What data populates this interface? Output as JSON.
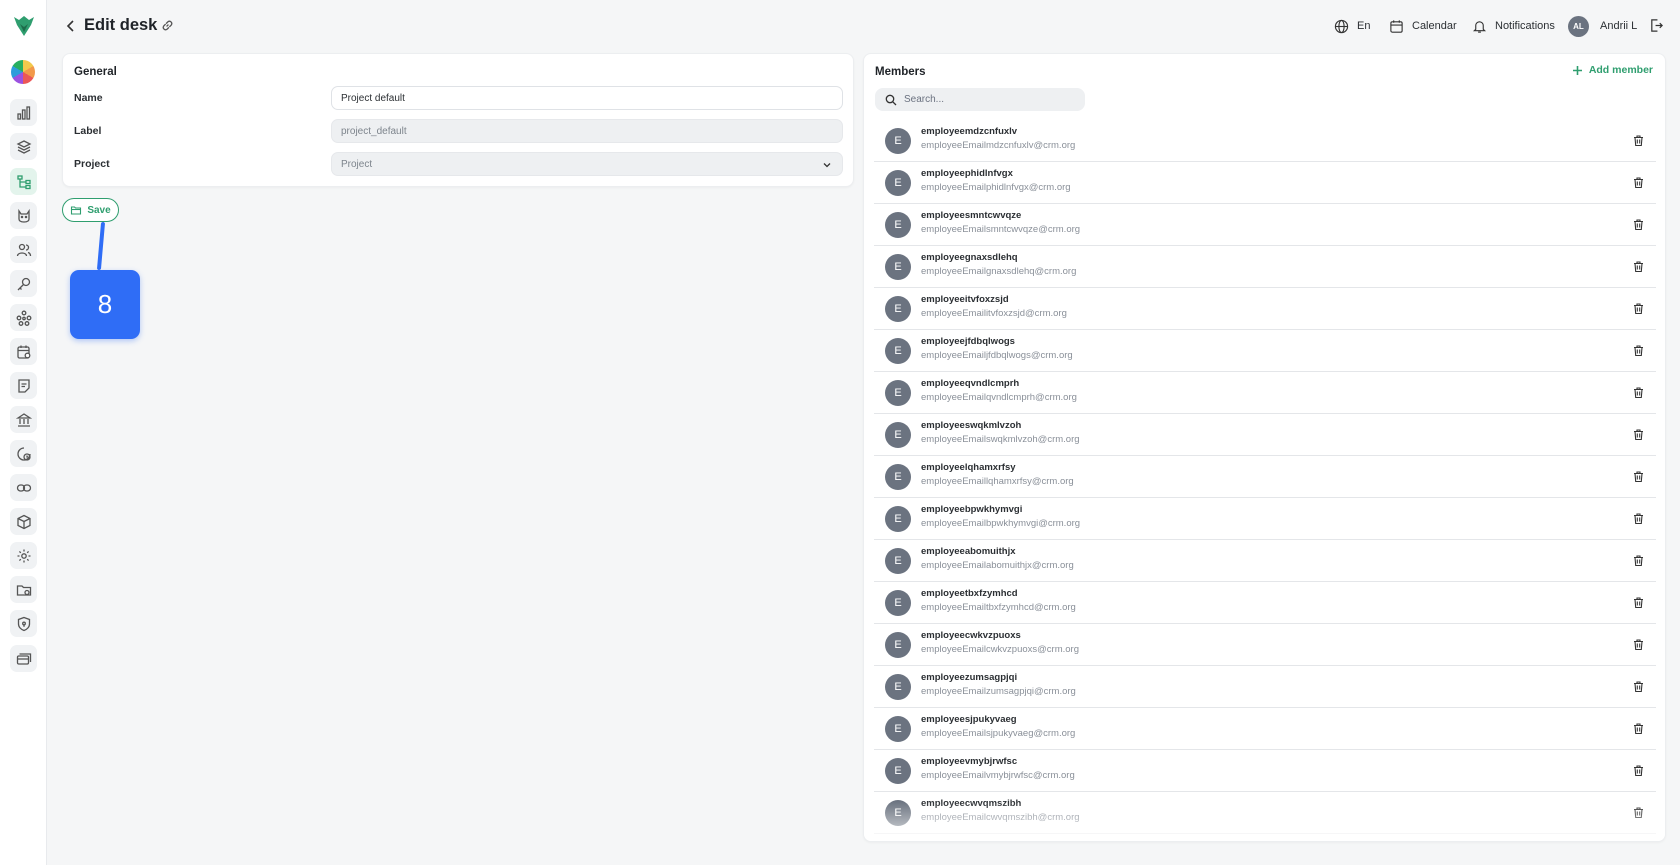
{
  "header": {
    "title": "Edit desk",
    "language": "En",
    "calendar": "Calendar",
    "notifications": "Notifications",
    "user_initials": "AL",
    "user_name": "Andrii L"
  },
  "general": {
    "title": "General",
    "name_label": "Name",
    "name_value": "Project default",
    "label_label": "Label",
    "label_value": "project_default",
    "project_label": "Project",
    "project_placeholder": "Project",
    "save_label": "Save"
  },
  "callout": {
    "number": "8"
  },
  "members": {
    "title": "Members",
    "add_label": "Add member",
    "search_placeholder": "Search...",
    "avatar_letter": "E",
    "items": [
      {
        "name": "employeemdzcnfuxlv",
        "email": "employeeEmailmdzcnfuxlv@crm.org"
      },
      {
        "name": "employeephidlnfvgx",
        "email": "employeeEmailphidlnfvgx@crm.org"
      },
      {
        "name": "employeesmntcwvqze",
        "email": "employeeEmailsmntcwvqze@crm.org"
      },
      {
        "name": "employeegnaxsdlehq",
        "email": "employeeEmailgnaxsdlehq@crm.org"
      },
      {
        "name": "employeeitvfoxzsjd",
        "email": "employeeEmailitvfoxzsjd@crm.org"
      },
      {
        "name": "employeejfdbqlwogs",
        "email": "employeeEmailjfdbqlwogs@crm.org"
      },
      {
        "name": "employeeqvndlcmprh",
        "email": "employeeEmailqvndlcmprh@crm.org"
      },
      {
        "name": "employeeswqkmlvzoh",
        "email": "employeeEmailswqkmlvzoh@crm.org"
      },
      {
        "name": "employeelqhamxrfsy",
        "email": "employeeEmaillqhamxrfsy@crm.org"
      },
      {
        "name": "employeebpwkhymvgi",
        "email": "employeeEmailbpwkhymvgi@crm.org"
      },
      {
        "name": "employeeabomuithjx",
        "email": "employeeEmailabomuithjx@crm.org"
      },
      {
        "name": "employeetbxfzymhcd",
        "email": "employeeEmailtbxfzymhcd@crm.org"
      },
      {
        "name": "employeecwkvzpuoxs",
        "email": "employeeEmailcwkvzpuoxs@crm.org"
      },
      {
        "name": "employeezumsagpjqi",
        "email": "employeeEmailzumsagpjqi@crm.org"
      },
      {
        "name": "employeesjpukyvaeg",
        "email": "employeeEmailsjpukyvaeg@crm.org"
      },
      {
        "name": "employeevmybjrwfsc",
        "email": "employeeEmailvmybjrwfsc@crm.org"
      },
      {
        "name": "employeecwvqmszibh",
        "email": "employeeEmailcwvqmszibh@crm.org"
      }
    ]
  },
  "colors": {
    "accent_green": "#2f9e6f",
    "callout_blue": "#2f6df6",
    "avatar_gray": "#6b7380"
  },
  "sidebar_icons": [
    "chart-icon",
    "layers-icon",
    "hierarchy-icon",
    "cat-icon",
    "users-icon",
    "key-icon",
    "network-icon",
    "calendar-settings-icon",
    "notes-icon",
    "bank-icon",
    "time-icon",
    "link-icon",
    "box-icon",
    "gear-icon",
    "folder-icon",
    "shield-icon",
    "cards-icon"
  ]
}
